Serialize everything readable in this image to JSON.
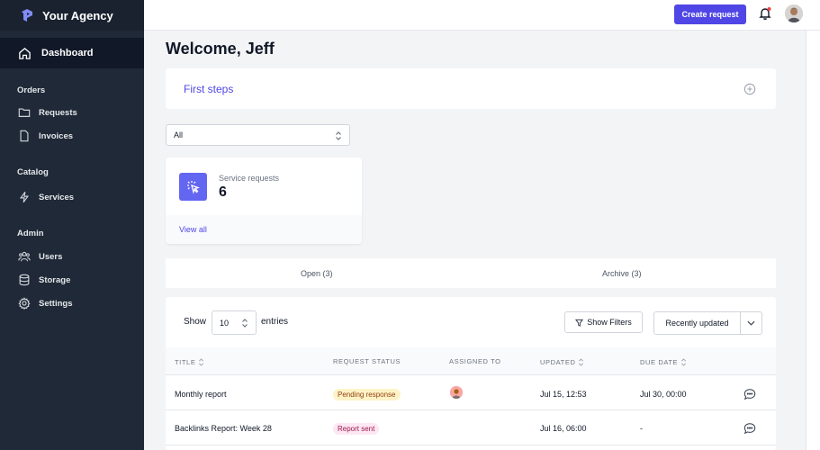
{
  "app": {
    "name": "Your Agency"
  },
  "sidebar": {
    "dashboard": "Dashboard",
    "sections": [
      {
        "title": "Orders",
        "items": [
          {
            "label": "Requests",
            "icon": "folder-icon"
          },
          {
            "label": "Invoices",
            "icon": "document-icon"
          }
        ]
      },
      {
        "title": "Catalog",
        "items": [
          {
            "label": "Services",
            "icon": "bolt-icon"
          }
        ]
      },
      {
        "title": "Admin",
        "items": [
          {
            "label": "Users",
            "icon": "users-icon"
          },
          {
            "label": "Storage",
            "icon": "database-icon"
          },
          {
            "label": "Settings",
            "icon": "gear-icon"
          }
        ]
      }
    ]
  },
  "topbar": {
    "create_label": "Create request"
  },
  "main": {
    "welcome": "Welcome, Jeff",
    "first_steps": "First steps",
    "filter_value": "All",
    "card": {
      "label": "Service requests",
      "count": "6",
      "link": "View all"
    },
    "tabs": [
      "Open (3)",
      "Archive (3)"
    ],
    "table": {
      "show_label": "Show",
      "entries_value": "10",
      "entries_label": "entries",
      "filters_label": "Show Filters",
      "sort_label": "Recently updated",
      "columns": [
        "TITLE",
        "REQUEST STATUS",
        "ASSIGNED TO",
        "UPDATED",
        "DUE DATE"
      ],
      "rows": [
        {
          "title": "Monthly report",
          "status": "Pending response",
          "updated": "Jul 15, 12:53",
          "due": "Jul 30, 00:00"
        },
        {
          "title": "Backlinks Report: Week 28",
          "status": "Report sent",
          "updated": "Jul 16, 06:00",
          "due": "-"
        }
      ]
    }
  },
  "colors": {
    "accent": "#4f46e5",
    "sidebar": "#1f2937",
    "pending": "#fef3c7",
    "sent": "#fce7f3"
  }
}
